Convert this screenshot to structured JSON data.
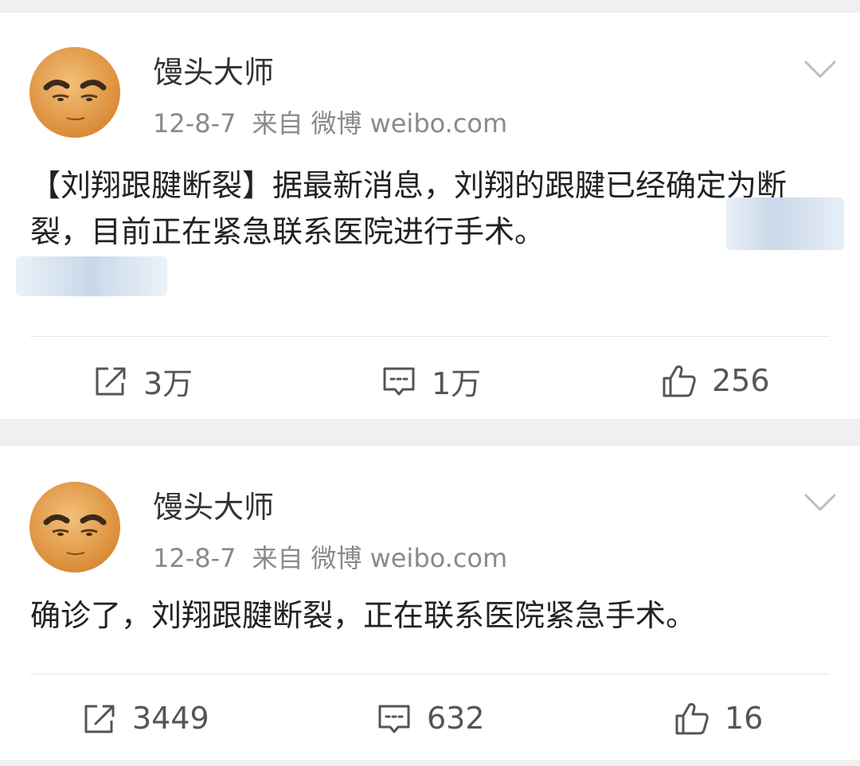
{
  "posts": [
    {
      "username": "馒头大师",
      "date": "12-8-7",
      "source_prefix": "来自",
      "source_app": "微博",
      "source_domain": "weibo.com",
      "content": "【刘翔跟腱断裂】据最新消息，刘翔的跟腱已经确定为断裂，目前正在紧急联系医院进行手术。",
      "repost_count": "3万",
      "comment_count": "1万",
      "like_count": "256"
    },
    {
      "username": "馒头大师",
      "date": "12-8-7",
      "source_prefix": "来自",
      "source_app": "微博",
      "source_domain": "weibo.com",
      "content": "确诊了，刘翔跟腱断裂，正在联系医院紧急手术。",
      "repost_count": "3449",
      "comment_count": "632",
      "like_count": "16"
    }
  ],
  "icons": {
    "avatar": "cartoon-face-avatar",
    "menu": "chevron-down-icon",
    "repost": "repost-icon",
    "comment": "comment-icon",
    "like": "thumbs-up-icon"
  },
  "colors": {
    "page_background": "#f0f0f0",
    "card_background": "#ffffff",
    "meta_text": "#8a8a8a",
    "avatar_skin": "#e8a24a"
  }
}
